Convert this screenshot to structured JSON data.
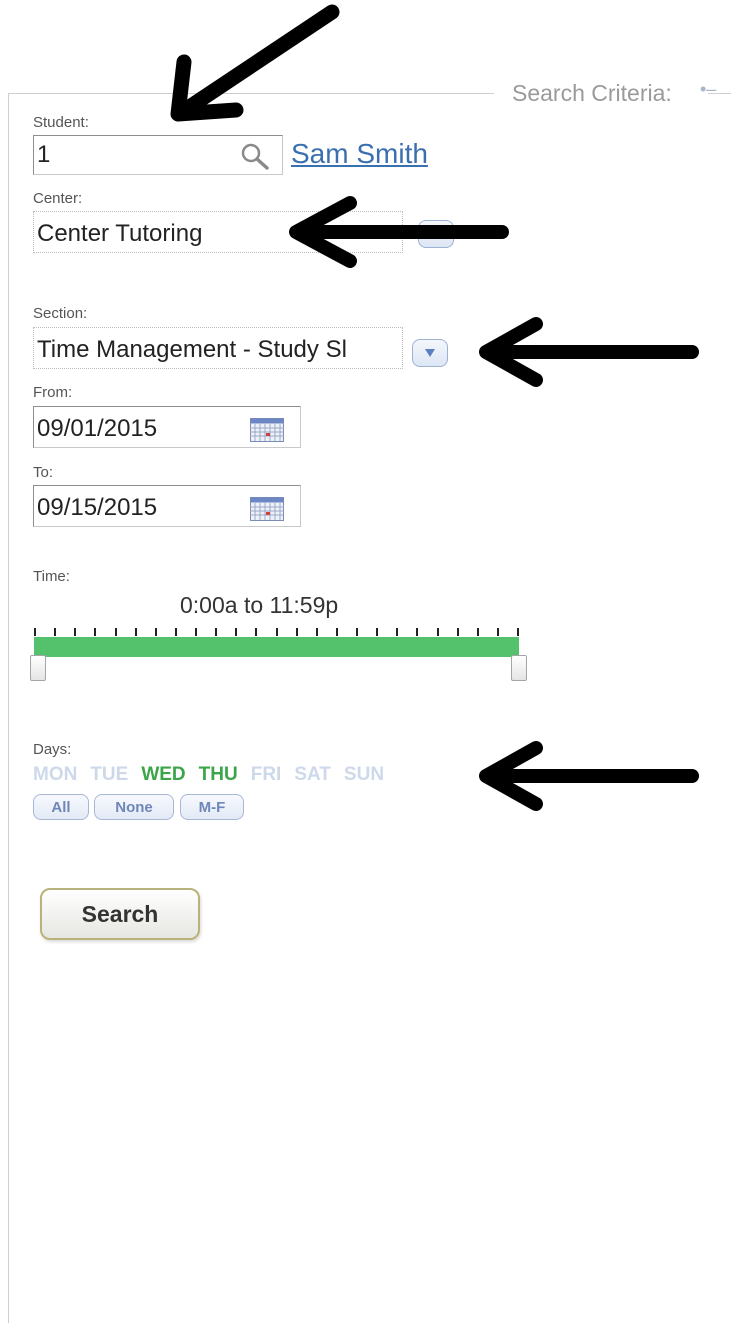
{
  "legend": "Search Criteria:",
  "student": {
    "label": "Student:",
    "value": "1",
    "name_link": "Sam Smith"
  },
  "center": {
    "label": "Center:",
    "value": "Center Tutoring"
  },
  "section": {
    "label": "Section:",
    "value": "Time Management - Study Sl"
  },
  "from": {
    "label": "From:",
    "value": "09/01/2015"
  },
  "to": {
    "label": "To:",
    "value": "09/15/2015"
  },
  "time": {
    "label": "Time:",
    "range_text": "0:00a to 11:59p",
    "range_start_fraction": 0.0,
    "range_end_fraction": 1.0
  },
  "days": {
    "label": "Days:",
    "items": [
      {
        "label": "MON",
        "selected": false
      },
      {
        "label": "TUE",
        "selected": false
      },
      {
        "label": "WED",
        "selected": true
      },
      {
        "label": "THU",
        "selected": true
      },
      {
        "label": "FRI",
        "selected": false
      },
      {
        "label": "SAT",
        "selected": false
      },
      {
        "label": "SUN",
        "selected": false
      }
    ],
    "buttons": [
      "All",
      "None",
      "M-F"
    ]
  },
  "search_button": "Search",
  "colors": {
    "day_selected": "#3aa649",
    "day_unselected": "#cdd9ea",
    "range": "#54c16c",
    "link": "#3a6fb0"
  },
  "icons": {
    "student_lookup": "search-icon",
    "date_picker": "calendar-icon",
    "dropdown": "chevron-down-icon",
    "annotation": "arrow-icon"
  }
}
